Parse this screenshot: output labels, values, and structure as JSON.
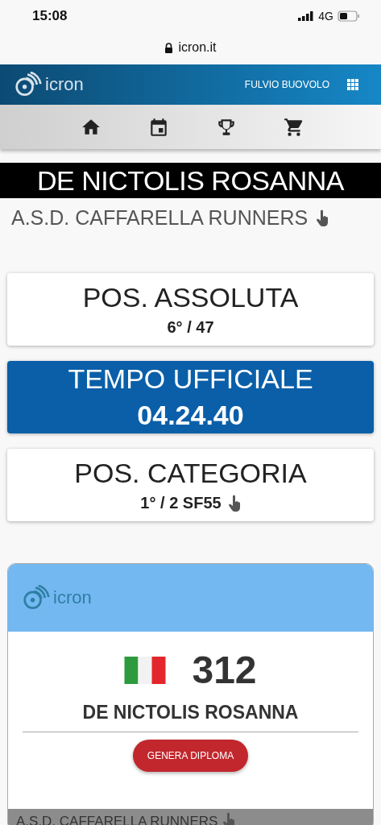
{
  "status_bar": {
    "time": "15:08",
    "network": "4G"
  },
  "address_bar": {
    "url": "icron.it"
  },
  "header": {
    "logo": "icron",
    "user": "FULVIO BUOVOLO"
  },
  "nav": [
    {
      "kind": "home"
    },
    {
      "kind": "calendar"
    },
    {
      "kind": "trophy"
    },
    {
      "kind": "cart"
    }
  ],
  "athlete": {
    "name": "DE NICTOLIS ROSANNA",
    "club": "A.S.D. CAFFARELLA RUNNERS"
  },
  "results": [
    {
      "kind": "plain",
      "title": "POS. ASSOLUTA",
      "value": "6° / 47",
      "tappable": false
    },
    {
      "kind": "highlight",
      "title": "TEMPO UFFICIALE",
      "value": "04.24.40",
      "tappable": false
    },
    {
      "kind": "plain",
      "title": "POS. CATEGORIA",
      "value": "1° / 2 SF55",
      "tappable": true
    }
  ],
  "bib_card": {
    "logo": "icron",
    "number": "312",
    "name": "DE NICTOLIS ROSANNA",
    "button": "GENERA DIPLOMA",
    "club": "A.S.D. CAFFARELLA RUNNERS"
  }
}
